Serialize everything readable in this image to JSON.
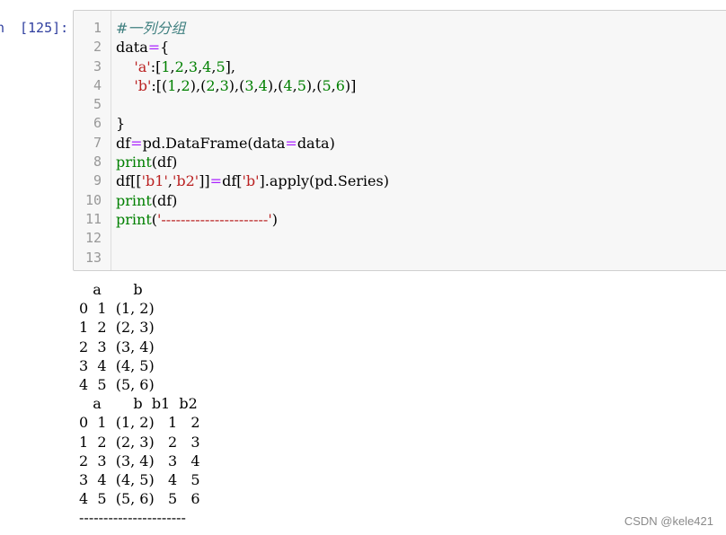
{
  "prompt": {
    "cut_text": "n",
    "execution_count": "[125]:"
  },
  "cell": {
    "line_numbers": [
      "1",
      "2",
      "3",
      "4",
      "5",
      "6",
      "7",
      "8",
      "9",
      "10",
      "11",
      "12",
      "13"
    ],
    "code_lines": [
      [
        {
          "t": "#一列分组",
          "c": "cm"
        }
      ],
      [
        {
          "t": "data",
          "c": ""
        },
        {
          "t": "=",
          "c": "op"
        },
        {
          "t": "{",
          "c": ""
        }
      ],
      [
        {
          "t": "    ",
          "c": ""
        },
        {
          "t": "'a'",
          "c": "st"
        },
        {
          "t": ":[",
          "c": ""
        },
        {
          "t": "1",
          "c": "nm"
        },
        {
          "t": ",",
          "c": ""
        },
        {
          "t": "2",
          "c": "nm"
        },
        {
          "t": ",",
          "c": ""
        },
        {
          "t": "3",
          "c": "nm"
        },
        {
          "t": ",",
          "c": ""
        },
        {
          "t": "4",
          "c": "nm"
        },
        {
          "t": ",",
          "c": ""
        },
        {
          "t": "5",
          "c": "nm"
        },
        {
          "t": "],",
          "c": ""
        }
      ],
      [
        {
          "t": "    ",
          "c": ""
        },
        {
          "t": "'b'",
          "c": "st"
        },
        {
          "t": ":[(",
          "c": ""
        },
        {
          "t": "1",
          "c": "nm"
        },
        {
          "t": ",",
          "c": ""
        },
        {
          "t": "2",
          "c": "nm"
        },
        {
          "t": "),(",
          "c": ""
        },
        {
          "t": "2",
          "c": "nm"
        },
        {
          "t": ",",
          "c": ""
        },
        {
          "t": "3",
          "c": "nm"
        },
        {
          "t": "),(",
          "c": ""
        },
        {
          "t": "3",
          "c": "nm"
        },
        {
          "t": ",",
          "c": ""
        },
        {
          "t": "4",
          "c": "nm"
        },
        {
          "t": "),(",
          "c": ""
        },
        {
          "t": "4",
          "c": "nm"
        },
        {
          "t": ",",
          "c": ""
        },
        {
          "t": "5",
          "c": "nm"
        },
        {
          "t": "),(",
          "c": ""
        },
        {
          "t": "5",
          "c": "nm"
        },
        {
          "t": ",",
          "c": ""
        },
        {
          "t": "6",
          "c": "nm"
        },
        {
          "t": ")]",
          "c": ""
        }
      ],
      [],
      [
        {
          "t": "}",
          "c": ""
        }
      ],
      [
        {
          "t": "df",
          "c": ""
        },
        {
          "t": "=",
          "c": "op"
        },
        {
          "t": "pd.DataFrame(data",
          "c": ""
        },
        {
          "t": "=",
          "c": "op"
        },
        {
          "t": "data)",
          "c": ""
        }
      ],
      [
        {
          "t": "print",
          "c": "kw"
        },
        {
          "t": "(df)",
          "c": ""
        }
      ],
      [
        {
          "t": "df[[",
          "c": ""
        },
        {
          "t": "'b1'",
          "c": "st"
        },
        {
          "t": ",",
          "c": ""
        },
        {
          "t": "'b2'",
          "c": "st"
        },
        {
          "t": "]]",
          "c": ""
        },
        {
          "t": "=",
          "c": "op"
        },
        {
          "t": "df[",
          "c": ""
        },
        {
          "t": "'b'",
          "c": "st"
        },
        {
          "t": "].apply(pd.Series)",
          "c": ""
        }
      ],
      [
        {
          "t": "print",
          "c": "kw"
        },
        {
          "t": "(df)",
          "c": ""
        }
      ],
      [
        {
          "t": "print",
          "c": "kw"
        },
        {
          "t": "(",
          "c": ""
        },
        {
          "t": "'----------------------'",
          "c": "st"
        },
        {
          "t": ")",
          "c": ""
        }
      ],
      [],
      []
    ]
  },
  "output": {
    "lines": [
      "   a       b",
      "0  1  (1, 2)",
      "1  2  (2, 3)",
      "2  3  (3, 4)",
      "3  4  (4, 5)",
      "4  5  (5, 6)",
      "   a       b  b1  b2",
      "0  1  (1, 2)   1   2",
      "1  2  (2, 3)   2   3",
      "2  3  (3, 4)   3   4",
      "3  4  (4, 5)   4   5",
      "4  5  (5, 6)   5   6",
      "----------------------"
    ]
  },
  "watermark": {
    "text": "CSDN @kele421"
  }
}
